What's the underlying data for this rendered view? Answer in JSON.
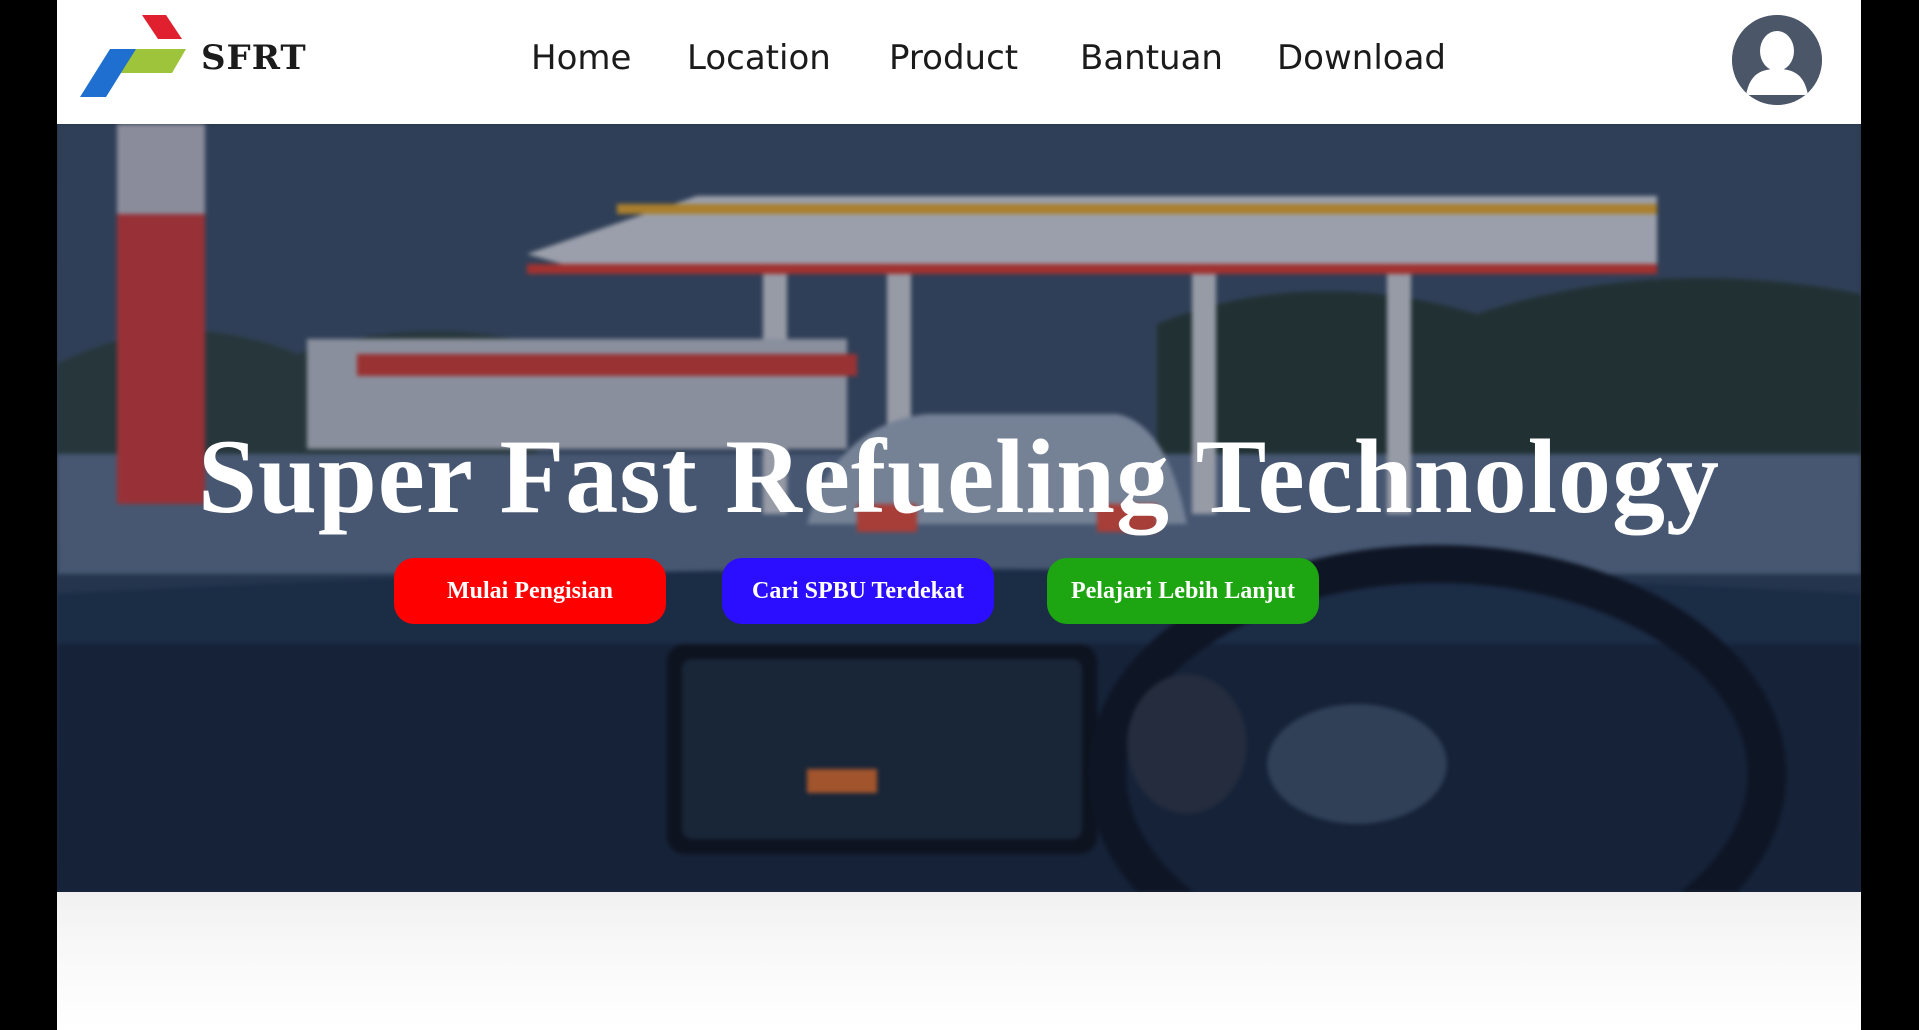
{
  "header": {
    "brand": "SFRT",
    "logo_icon": "pertamina-logo-icon",
    "avatar_icon": "user-avatar-icon",
    "nav": [
      {
        "label": "Home"
      },
      {
        "label": "Location"
      },
      {
        "label": "Product"
      },
      {
        "label": "Bantuan"
      },
      {
        "label": "Download"
      }
    ]
  },
  "hero": {
    "title": "Super Fast Refueling Technology",
    "buttons": [
      {
        "label": "Mulai Pengisian",
        "color": "#ff0000"
      },
      {
        "label": "Cari SPBU Terdekat",
        "color": "#2b0dff"
      },
      {
        "label": "Pelajari Lebih Lanjut",
        "color": "#1da612"
      }
    ]
  },
  "colors": {
    "logo_red": "#e0202e",
    "logo_green": "#9dc43a",
    "logo_blue": "#1e6fd0",
    "avatar": "#4b5768"
  }
}
